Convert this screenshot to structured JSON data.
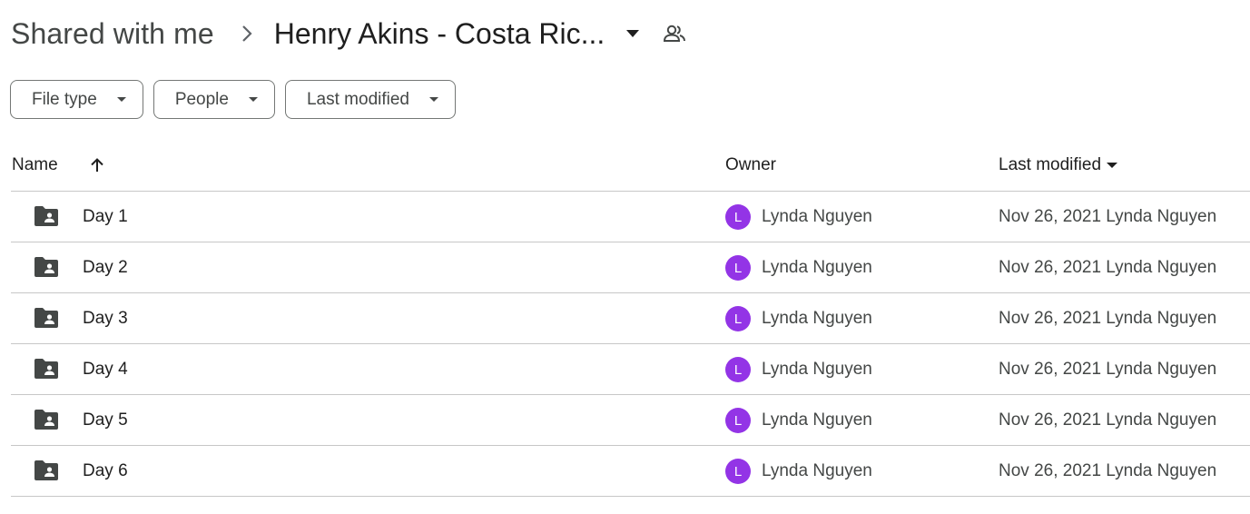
{
  "breadcrumb": {
    "root": "Shared with me",
    "current": "Henry Akins - Costa Ric..."
  },
  "icons": {
    "separator": "chevron-right-icon",
    "dropdown": "arrow-drop-down-icon",
    "shared": "people-icon",
    "folder": "shared-folder-icon",
    "sort": "arrow-up-icon"
  },
  "filters": [
    {
      "label": "File type"
    },
    {
      "label": "People"
    },
    {
      "label": "Last modified"
    }
  ],
  "table": {
    "headers": {
      "name": "Name",
      "owner": "Owner",
      "last_modified": "Last modified"
    },
    "rows": [
      {
        "name": "Day 1",
        "avatar": "L",
        "owner": "Lynda Nguyen",
        "modified": "Nov 26, 2021 Lynda Nguyen"
      },
      {
        "name": "Day 2",
        "avatar": "L",
        "owner": "Lynda Nguyen",
        "modified": "Nov 26, 2021 Lynda Nguyen"
      },
      {
        "name": "Day 3",
        "avatar": "L",
        "owner": "Lynda Nguyen",
        "modified": "Nov 26, 2021 Lynda Nguyen"
      },
      {
        "name": "Day 4",
        "avatar": "L",
        "owner": "Lynda Nguyen",
        "modified": "Nov 26, 2021 Lynda Nguyen"
      },
      {
        "name": "Day 5",
        "avatar": "L",
        "owner": "Lynda Nguyen",
        "modified": "Nov 26, 2021 Lynda Nguyen"
      },
      {
        "name": "Day 6",
        "avatar": "L",
        "owner": "Lynda Nguyen",
        "modified": "Nov 26, 2021 Lynda Nguyen"
      }
    ]
  },
  "colors": {
    "avatar": "#9334e6",
    "folder": "#444746"
  }
}
